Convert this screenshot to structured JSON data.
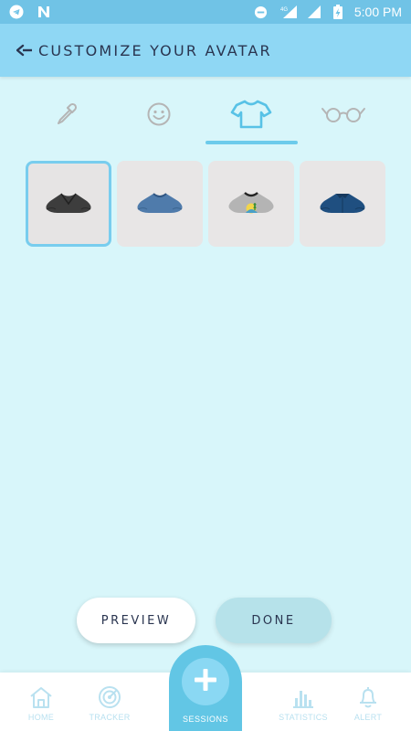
{
  "status_bar": {
    "time": "5:00 PM",
    "network": "4G"
  },
  "app_bar": {
    "title": "CUSTOMIZE YOUR AVATAR"
  },
  "tabs": [
    {
      "icon": "eyedropper-icon"
    },
    {
      "icon": "smiley-icon"
    },
    {
      "icon": "tshirt-icon",
      "active": true
    },
    {
      "icon": "glasses-icon"
    }
  ],
  "items": [
    {
      "icon": "black-shirt-icon",
      "color": "#3a3a3a",
      "selected": true
    },
    {
      "icon": "blue-shirt-icon",
      "color": "#4e79a7"
    },
    {
      "icon": "grey-graphic-shirt-icon",
      "color": "#a9a9a9"
    },
    {
      "icon": "navy-shirt-icon",
      "color": "#1d4f7f"
    }
  ],
  "buttons": {
    "preview_label": "PREVIEW",
    "done_label": "DONE"
  },
  "nav": {
    "home": "HOME",
    "tracker": "TRACKER",
    "sessions": "SESSIONS",
    "statistics": "STATISTICS",
    "alert": "ALERT"
  },
  "colors": {
    "background": "#d8f6fa",
    "app_bar": "#8fd7f4",
    "status_bar": "#70c3e6",
    "accent": "#6ccbeb",
    "sessions": "#62c6e5"
  }
}
